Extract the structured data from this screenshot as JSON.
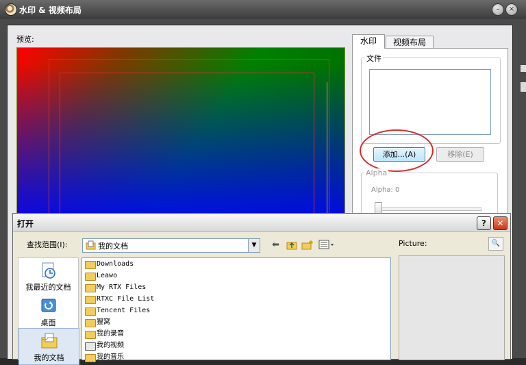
{
  "window": {
    "title": "水印 & 视频布局",
    "minimize_glyph": "–",
    "close_glyph": "×"
  },
  "preview": {
    "label": "预览:"
  },
  "tabs": [
    {
      "label": "水印",
      "active": true
    },
    {
      "label": "视频布局",
      "active": false
    }
  ],
  "watermark": {
    "file_group_label": "文件",
    "add_button": "添加...(A)",
    "remove_button": "移除(E)",
    "alpha_group_label": "Alpha",
    "alpha_value_label": "Alpha: 0",
    "alpha_level": 0
  },
  "open_dialog": {
    "title": "打开",
    "help_glyph": "?",
    "close_glyph": "✕",
    "look_in_label": "查找范围(I):",
    "look_in_value": "我的文档",
    "places": [
      {
        "label": "我最近的文档",
        "icon": "recent-documents-icon"
      },
      {
        "label": "桌面",
        "icon": "desktop-icon"
      },
      {
        "label": "我的文档",
        "icon": "my-documents-icon"
      }
    ],
    "files": [
      {
        "name": "Downloads",
        "icon": "folder-icon"
      },
      {
        "name": "Leawo",
        "icon": "folder-icon"
      },
      {
        "name": "My RTX Files",
        "icon": "folder-icon"
      },
      {
        "name": "RTXC File List",
        "icon": "folder-icon"
      },
      {
        "name": "Tencent Files",
        "icon": "folder-icon"
      },
      {
        "name": "狸窝",
        "icon": "folder-icon"
      },
      {
        "name": "我的录音",
        "icon": "folder-icon"
      },
      {
        "name": "我的视频",
        "icon": "video-folder-icon"
      },
      {
        "name": "我的音乐",
        "icon": "music-folder-icon"
      }
    ],
    "picture_label": "Picture:"
  },
  "colors": {
    "accent_red": "#d92a2a",
    "title_dark": "#3c3c3c",
    "dialog_bg": "#ece9d8"
  }
}
